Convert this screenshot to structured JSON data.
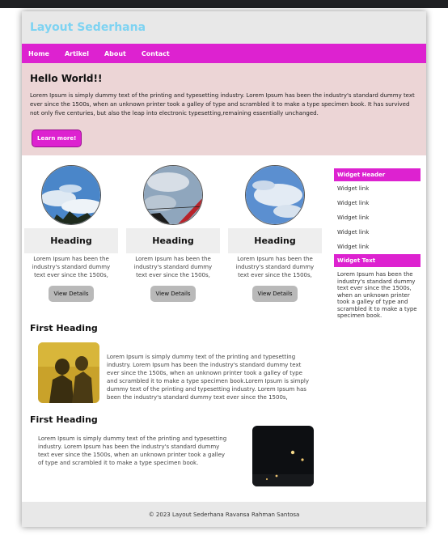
{
  "header": {
    "title": "Layout Sederhana"
  },
  "nav": {
    "items": [
      "Home",
      "Artikel",
      "About",
      "Contact"
    ]
  },
  "jumbotron": {
    "title": "Hello World!!",
    "text": "Lorem Ipsum is simply dummy text of the printing and typesetting industry. Lorem Ipsum has been the industry's standard dummy text ever since the 1500s, when an unknown printer took a galley of type and scrambled it to make a type specimen book. It has survived not only five centuries, but also the leap into electronic typesetting,remaining essentially unchanged.",
    "button": "Learn more!"
  },
  "cards": [
    {
      "heading": "Heading",
      "text": "Lorem Ipsum has been the industry's standard dummy text ever since the 1500s,",
      "button": "View Details",
      "image": "sky-clouds-tree-photo"
    },
    {
      "heading": "Heading",
      "text": "Lorem Ipsum has been the industry's standard dummy text ever since the 1500s,",
      "button": "View Details",
      "image": "sky-clouds-roof-photo"
    },
    {
      "heading": "Heading",
      "text": "Lorem Ipsum has been the industry's standard dummy text ever since the 1500s,",
      "button": "View Details",
      "image": "sky-clouds-photo"
    }
  ],
  "sidebar": {
    "widget_header": "Widget Header",
    "links": [
      "Widget link",
      "Widget link",
      "Widget link",
      "Widget link",
      "Widget link"
    ],
    "widget_text_title": "Widget Text",
    "widget_text": "Lorem Ipsum has been the industry's standard dummy text ever since the 1500s, when an unknown printer took a galley of type and scrambled it to make a type specimen book."
  },
  "articles": [
    {
      "heading": "First Heading",
      "text": "Lorem Ipsum is simply dummy text of the printing and typesetting industry. Lorem Ipsum has been the industry's standard dummy text ever since the 1500s, when an unknown printer took a galley of type and scrambled it to make a type specimen book.Lorem Ipsum is simply dummy text of the printing and typesetting industry. Lorem Ipsum has been the industry's standard dummy text ever since the 1500s,"
    },
    {
      "heading": "First Heading",
      "text": "Lorem Ipsum is simply dummy text of the printing and typesetting industry. Lorem Ipsum has been the industry's standard dummy text ever since the 1500s, when an unknown printer took a galley of type and scrambled it to make a type specimen book."
    }
  ],
  "footer": {
    "text": "© 2023 Layout Sederhana Ravansa Rahman Santosa"
  },
  "colors": {
    "accent": "#dd22d0",
    "title": "#7ed3f2",
    "jumbotron_bg": "#ecd5d6",
    "header_bg": "#e8e8e8"
  }
}
